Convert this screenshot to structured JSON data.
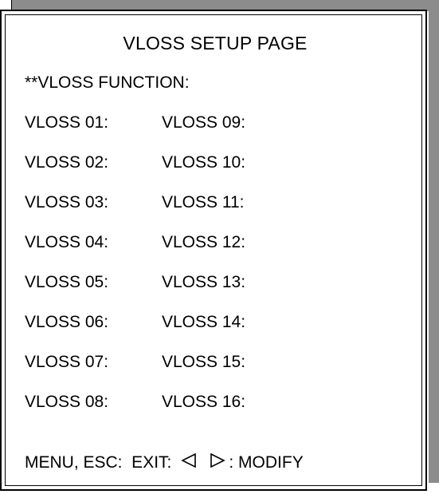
{
  "page": {
    "title": "VLOSS SETUP PAGE",
    "function_label": "**VLOSS FUNCTION:"
  },
  "channels": [
    {
      "left": "VLOSS 01:",
      "right": "VLOSS 09:"
    },
    {
      "left": "VLOSS 02:",
      "right": "VLOSS 10:"
    },
    {
      "left": "VLOSS 03:",
      "right": "VLOSS 11:"
    },
    {
      "left": "VLOSS 04:",
      "right": "VLOSS 12:"
    },
    {
      "left": "VLOSS 05:",
      "right": "VLOSS 13:"
    },
    {
      "left": "VLOSS 06:",
      "right": "VLOSS 14:"
    },
    {
      "left": "VLOSS 07:",
      "right": "VLOSS 15:"
    },
    {
      "left": "VLOSS 08:",
      "right": "VLOSS 16:"
    }
  ],
  "footer": {
    "exit_label": "MENU, ESC:  EXIT:",
    "left_icon": "left-triangle-icon",
    "right_icon": "right-triangle-icon",
    "modify_label": ": MODIFY"
  },
  "colors": {
    "background": "#ffffff",
    "frame": "#000000",
    "shadow": "#8c8c8c"
  }
}
